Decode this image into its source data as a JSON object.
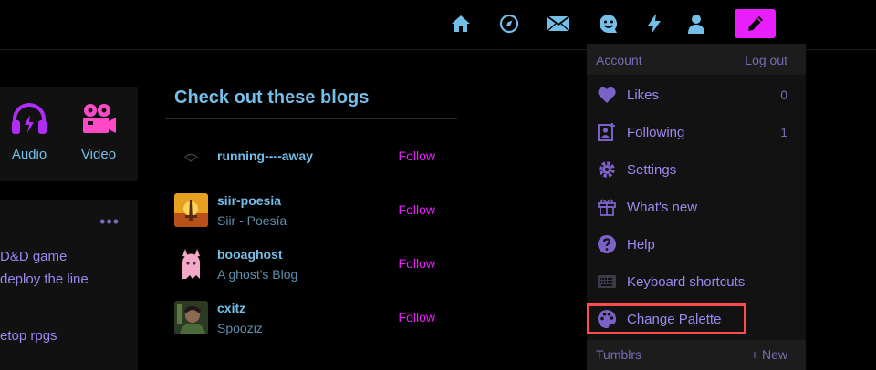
{
  "colors": {
    "accent": "#e91efc",
    "link_blue": "#74bfe8",
    "muted_purple": "#9f87f0",
    "highlight": "#ff4c4c"
  },
  "nav": {
    "icons": [
      "home-icon",
      "explore-icon",
      "inbox-icon",
      "messages-icon",
      "activity-icon",
      "account-icon"
    ],
    "compose_icon": "pencil-icon"
  },
  "media": {
    "audio_label": "Audio",
    "video_label": "Video"
  },
  "post": {
    "line1": "D&D game",
    "line2": "deploy the line",
    "tag": "etop rpgs",
    "dots": "•••"
  },
  "blogs": {
    "title": "Check out these blogs",
    "follow_label": "Follow",
    "items": [
      {
        "name": "running----away",
        "subtitle": ""
      },
      {
        "name": "siir-poesia",
        "subtitle": "Siir - Poesía"
      },
      {
        "name": "booaghost",
        "subtitle": "A ghost's Blog"
      },
      {
        "name": "cxitz",
        "subtitle": "Spooziz"
      }
    ]
  },
  "dropdown": {
    "header_left": "Account",
    "header_right": "Log out",
    "items": [
      {
        "label": "Likes",
        "count": "0",
        "icon": "heart-icon"
      },
      {
        "label": "Following",
        "count": "1",
        "icon": "following-icon"
      },
      {
        "label": "Settings",
        "count": "",
        "icon": "gear-icon"
      },
      {
        "label": "What's new",
        "count": "",
        "icon": "gift-icon"
      },
      {
        "label": "Help",
        "count": "",
        "icon": "help-icon"
      },
      {
        "label": "Keyboard shortcuts",
        "count": "",
        "icon": "keyboard-icon"
      },
      {
        "label": "Change Palette",
        "count": "",
        "icon": "palette-icon"
      }
    ],
    "footer_left": "Tumblrs",
    "footer_right": "+ New"
  }
}
